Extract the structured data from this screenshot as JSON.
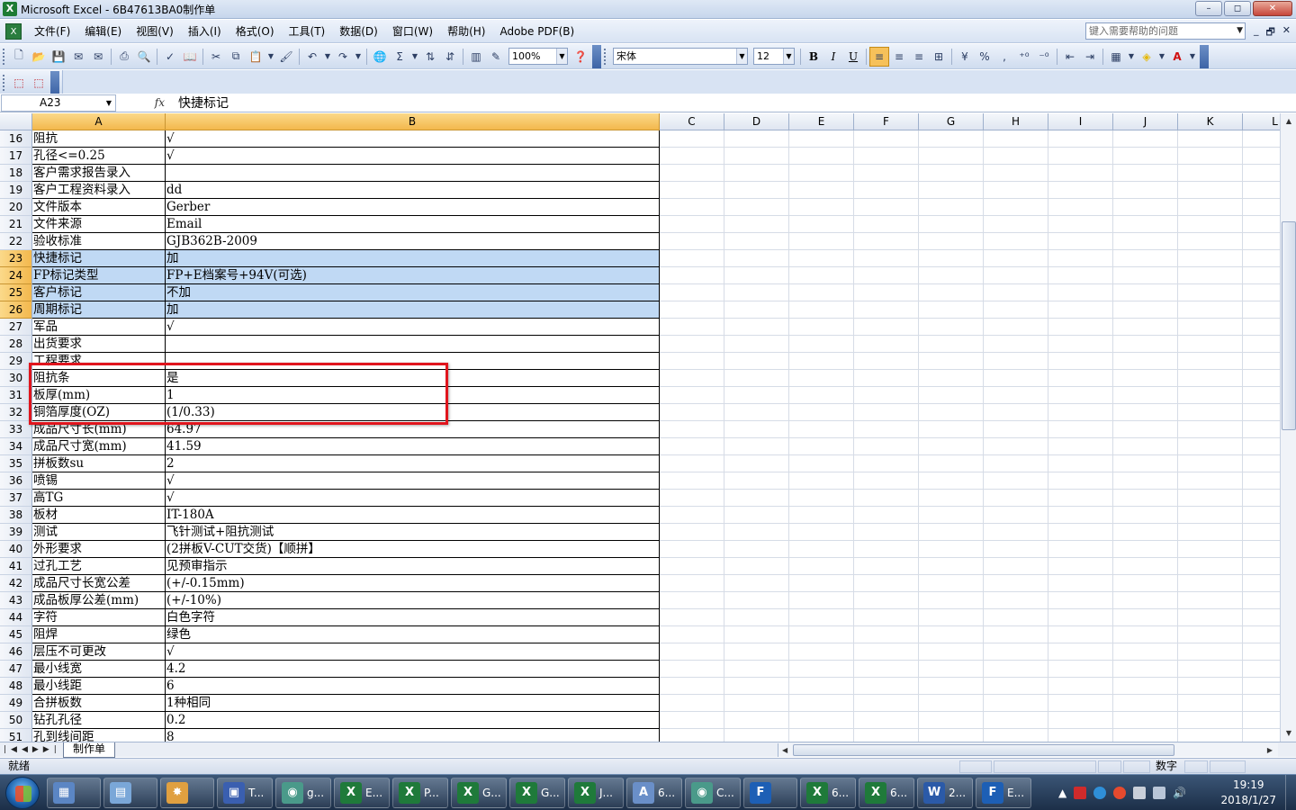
{
  "window": {
    "title": "Microsoft Excel - 6B47613BA0制作单",
    "buttons": [
      "–",
      "◻",
      "✕"
    ]
  },
  "menu": {
    "items": [
      "文件(F)",
      "编辑(E)",
      "视图(V)",
      "插入(I)",
      "格式(O)",
      "工具(T)",
      "数据(D)",
      "窗口(W)",
      "帮助(H)",
      "Adobe PDF(B)"
    ],
    "help_placeholder": "键入需要帮助的问题",
    "mdi_buttons": [
      "_",
      "🗗",
      "✕"
    ]
  },
  "toolbar": {
    "zoom": "100%",
    "font_name": "宋体",
    "font_size": "12",
    "bold_label": "B",
    "italic_label": "I",
    "underline_label": "U",
    "sum_label": "Σ",
    "percent_label": "%",
    "comma_label": ","
  },
  "formula_bar": {
    "name_box": "A23",
    "fx_label": "fx",
    "content": "快捷标记"
  },
  "columns": [
    {
      "label": "A",
      "selected": true
    },
    {
      "label": "B",
      "selected": true
    },
    {
      "label": "C",
      "selected": false
    },
    {
      "label": "D",
      "selected": false
    },
    {
      "label": "E",
      "selected": false
    },
    {
      "label": "F",
      "selected": false
    },
    {
      "label": "G",
      "selected": false
    },
    {
      "label": "H",
      "selected": false
    },
    {
      "label": "I",
      "selected": false
    },
    {
      "label": "J",
      "selected": false
    },
    {
      "label": "K",
      "selected": false
    },
    {
      "label": "L",
      "selected": false
    }
  ],
  "rows": [
    {
      "num": "16",
      "a": "阻抗",
      "b": "√"
    },
    {
      "num": "17",
      "a": "孔径<=0.25",
      "b": "√"
    },
    {
      "num": "18",
      "a": "客户需求报告录入",
      "b": ""
    },
    {
      "num": "19",
      "a": "客户工程资料录入",
      "b": "dd"
    },
    {
      "num": "20",
      "a": "文件版本",
      "b": "Gerber"
    },
    {
      "num": "21",
      "a": "文件来源",
      "b": "Email"
    },
    {
      "num": "22",
      "a": "验收标准",
      "b": "GJB362B-2009"
    },
    {
      "num": "23",
      "a": "快捷标记",
      "b": "加",
      "selected": true
    },
    {
      "num": "24",
      "a": "FP标记类型",
      "b": "FP+E档案号+94V(可选)",
      "selected": true
    },
    {
      "num": "25",
      "a": "客户标记",
      "b": "不加",
      "selected": true
    },
    {
      "num": "26",
      "a": "周期标记",
      "b": "加",
      "selected": true
    },
    {
      "num": "27",
      "a": "军品",
      "b": "√"
    },
    {
      "num": "28",
      "a": "出货要求",
      "b": ""
    },
    {
      "num": "29",
      "a": "工程要求",
      "b": ""
    },
    {
      "num": "30",
      "a": "阻抗条",
      "b": "是"
    },
    {
      "num": "31",
      "a": "板厚(mm)",
      "b": "1"
    },
    {
      "num": "32",
      "a": "铜箔厚度(OZ)",
      "b": "(1/0.33)"
    },
    {
      "num": "33",
      "a": "成品尺寸长(mm)",
      "b": "64.97"
    },
    {
      "num": "34",
      "a": "成品尺寸宽(mm)",
      "b": "41.59"
    },
    {
      "num": "35",
      "a": "拼板数su",
      "b": "2"
    },
    {
      "num": "36",
      "a": "喷锡",
      "b": "√"
    },
    {
      "num": "37",
      "a": "高TG",
      "b": "√"
    },
    {
      "num": "38",
      "a": "板材",
      "b": "IT-180A"
    },
    {
      "num": "39",
      "a": "测试",
      "b": "飞针测试+阻抗测试"
    },
    {
      "num": "40",
      "a": "外形要求",
      "b": "(2拼板V-CUT交货)【顺拼】"
    },
    {
      "num": "41",
      "a": "过孔工艺",
      "b": "见预审指示"
    },
    {
      "num": "42",
      "a": "成品尺寸长宽公差",
      "b": "(+/-0.15mm)"
    },
    {
      "num": "43",
      "a": "成品板厚公差(mm)",
      "b": "(+/-10%)"
    },
    {
      "num": "44",
      "a": "字符",
      "b": "白色字符"
    },
    {
      "num": "45",
      "a": "阻焊",
      "b": "绿色"
    },
    {
      "num": "46",
      "a": "层压不可更改",
      "b": "√"
    },
    {
      "num": "47",
      "a": "最小线宽",
      "b": "4.2"
    },
    {
      "num": "48",
      "a": "最小线距",
      "b": "6"
    },
    {
      "num": "49",
      "a": "合拼板数",
      "b": "1种相同"
    },
    {
      "num": "50",
      "a": "钻孔孔径",
      "b": "0.2"
    },
    {
      "num": "51",
      "a": "孔到线间距",
      "b": "8"
    }
  ],
  "sheet_tabs": [
    "制作单"
  ],
  "status": {
    "ready": "就绪",
    "mode": "数字"
  },
  "taskbar": {
    "tasks": [
      {
        "label": "",
        "icon": "calculator-icon"
      },
      {
        "label": "",
        "icon": "notepad-icon"
      },
      {
        "label": "",
        "icon": "shell-icon"
      },
      {
        "label": "T...",
        "icon": "floppy-icon"
      },
      {
        "label": "g...",
        "icon": "app-icon"
      },
      {
        "label": "E...",
        "icon": "excel-icon"
      },
      {
        "label": "P...",
        "icon": "excel-icon"
      },
      {
        "label": "G...",
        "icon": "excel-icon"
      },
      {
        "label": "G...",
        "icon": "excel-icon"
      },
      {
        "label": "J...",
        "icon": "excel-icon"
      },
      {
        "label": "6...",
        "icon": "document-icon"
      },
      {
        "label": "C...",
        "icon": "app-icon"
      },
      {
        "label": "",
        "icon": "f-icon"
      },
      {
        "label": "6...",
        "icon": "excel-icon"
      },
      {
        "label": "6...",
        "icon": "excel-icon"
      },
      {
        "label": "2...",
        "icon": "word-icon"
      },
      {
        "label": "E...",
        "icon": "f-icon"
      }
    ],
    "time": "19:19",
    "date": "2018/1/27"
  }
}
